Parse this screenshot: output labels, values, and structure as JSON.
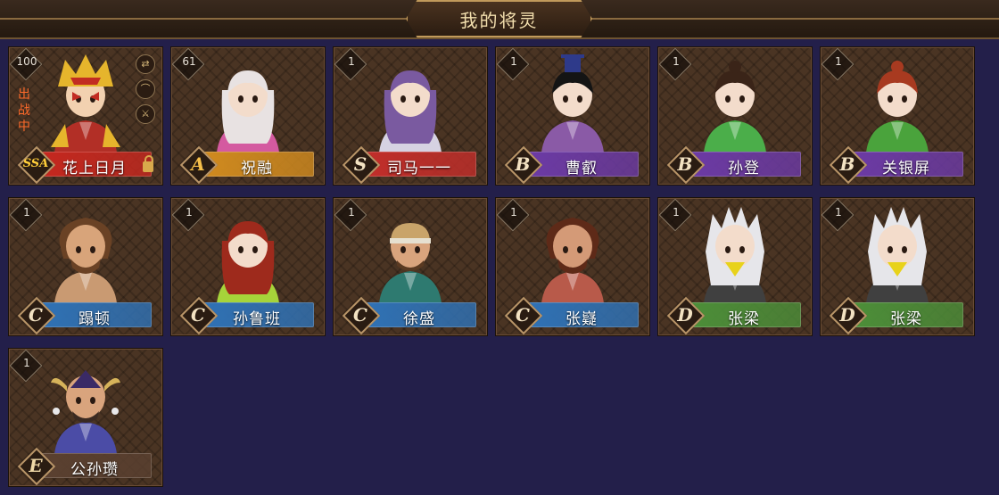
{
  "title": "我的将灵",
  "colors": {
    "grade_SSA": "#c6281f",
    "grade_A": "#d18b1f",
    "grade_S": "#c22e2a",
    "grade_B": "#6c3aa6",
    "grade_C": "#2f72b6",
    "grade_D": "#4c8f39",
    "grade_E": "#5a4030"
  },
  "deployed": {
    "status": "出战中",
    "icons": [
      "swap-icon",
      "hat-icon",
      "sword-icon",
      "lock-icon"
    ]
  },
  "cards": [
    {
      "level": "100",
      "grade": "SSA",
      "name": "花上日月",
      "skin": "#f2d1b0",
      "hair": "#d6a23a",
      "outfit": "#b22f26",
      "head_style": "opera"
    },
    {
      "level": "61",
      "grade": "A",
      "name": "祝融",
      "skin": "#f3dccb",
      "hair": "#e8e2e2",
      "outfit": "#d45aa0",
      "head_style": "long"
    },
    {
      "level": "1",
      "grade": "S",
      "name": "司马一一",
      "skin": "#f3dccb",
      "hair": "#7a5aa0",
      "outfit": "#d6d2e2",
      "head_style": "long"
    },
    {
      "level": "1",
      "grade": "B",
      "name": "曹叡",
      "skin": "#f3dccb",
      "hair": "#141414",
      "outfit": "#8a5aa6",
      "head_style": "hat"
    },
    {
      "level": "1",
      "grade": "B",
      "name": "孙登",
      "skin": "#f3dccb",
      "hair": "#3a2418",
      "outfit": "#4bae4a",
      "head_style": "bun"
    },
    {
      "level": "1",
      "grade": "B",
      "name": "关银屏",
      "skin": "#f3dccb",
      "hair": "#a83a20",
      "outfit": "#4aa33c",
      "head_style": "bun"
    },
    {
      "level": "1",
      "grade": "C",
      "name": "蹋顿",
      "skin": "#d8a47a",
      "hair": "#6a4225",
      "outfit": "#c99a72",
      "head_style": "wild"
    },
    {
      "level": "1",
      "grade": "C",
      "name": "孙鲁班",
      "skin": "#f3dccb",
      "hair": "#9e2a1c",
      "outfit": "#a6d43a",
      "head_style": "long"
    },
    {
      "level": "1",
      "grade": "C",
      "name": "徐盛",
      "skin": "#d9a47d",
      "hair": "#5a3a22",
      "outfit": "#2e7a70",
      "head_style": "band"
    },
    {
      "level": "1",
      "grade": "C",
      "name": "张嶷",
      "skin": "#d49a77",
      "hair": "#5e2a18",
      "outfit": "#b85a4a",
      "head_style": "wild"
    },
    {
      "level": "1",
      "grade": "D",
      "name": "张梁",
      "skin": "#f3dccb",
      "hair": "#e6e6ea",
      "outfit": "#404040",
      "head_style": "spiky"
    },
    {
      "level": "1",
      "grade": "D",
      "name": "张梁",
      "skin": "#f3dccb",
      "hair": "#e6e6ea",
      "outfit": "#404040",
      "head_style": "spiky"
    },
    {
      "level": "1",
      "grade": "E",
      "name": "公孙瓒",
      "skin": "#d9a47d",
      "hair": "#3a2a66",
      "outfit": "#4b4ca6",
      "head_style": "horned"
    }
  ]
}
